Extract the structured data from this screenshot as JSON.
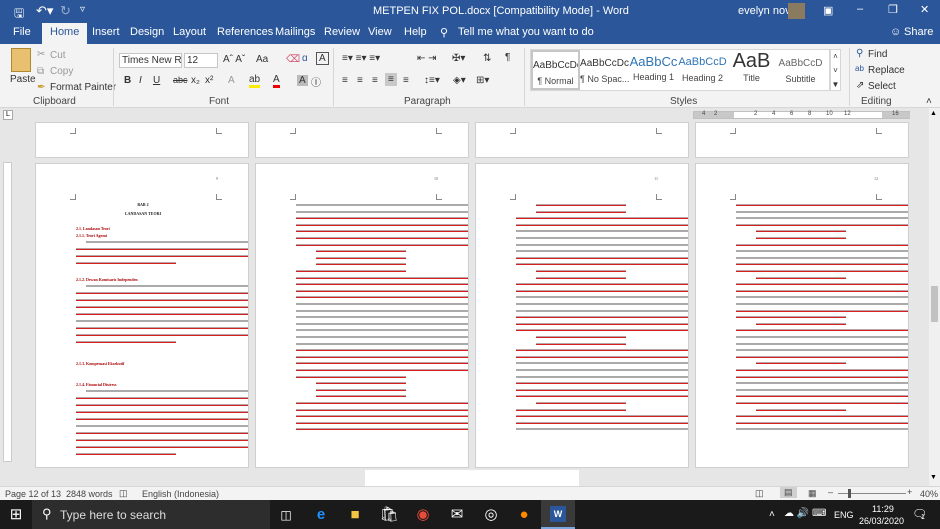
{
  "titlebar": {
    "title": "METPEN FIX POL.docx [Compatibility Mode]  -  Word",
    "user": "evelyn nova",
    "save_icon": "save-icon",
    "undo_icon": "undo-icon",
    "redo_icon": "redo-icon"
  },
  "tabs": [
    {
      "label": "File"
    },
    {
      "label": "Home",
      "active": true
    },
    {
      "label": "Insert"
    },
    {
      "label": "Design"
    },
    {
      "label": "Layout"
    },
    {
      "label": "References"
    },
    {
      "label": "Mailings"
    },
    {
      "label": "Review"
    },
    {
      "label": "View"
    },
    {
      "label": "Help"
    }
  ],
  "tell_me": "Tell me what you want to do",
  "share": "Share",
  "clipboard": {
    "paste": "Paste",
    "cut": "Cut",
    "copy": "Copy",
    "format_painter": "Format Painter",
    "group": "Clipboard"
  },
  "font": {
    "name": "Times New R",
    "size": "12",
    "group": "Font",
    "case": "Aa"
  },
  "paragraph": {
    "group": "Paragraph"
  },
  "styles": {
    "group": "Styles",
    "items": [
      {
        "preview": "AaBbCcDc",
        "name": "¶ Normal"
      },
      {
        "preview": "AaBbCcDc",
        "name": "¶ No Spac..."
      },
      {
        "preview": "AaBbCc",
        "name": "Heading 1"
      },
      {
        "preview": "AaBbCcD",
        "name": "Heading 2"
      },
      {
        "preview": "AaB",
        "name": "Title"
      },
      {
        "preview": "AaBbCcD",
        "name": "Subtitle"
      }
    ]
  },
  "editing": {
    "find": "Find",
    "replace": "Replace",
    "select": "Select",
    "group": "Editing"
  },
  "ruler": {
    "ticks": [
      "4",
      "2",
      "2",
      "4",
      "6",
      "8",
      "10",
      "12",
      "16"
    ]
  },
  "pages": [
    {
      "num": "9",
      "headings": [
        "BAB 2",
        "LANDASAN TEORI",
        "2.1. Landasan Teori",
        "2.1.1. Teori Agensi",
        "2.1.2. Dewan Komisaris Independen",
        "2.1.3. Kompensasi Eksekutif",
        "2.1.4. Financial Distress"
      ]
    },
    {
      "num": "10"
    },
    {
      "num": "11"
    },
    {
      "num": "12"
    }
  ],
  "status": {
    "page": "Page 12 of 13",
    "words": "2848 words",
    "language": "English (Indonesia)",
    "zoom": "40%"
  },
  "taskbar": {
    "search": "Type here to search",
    "time": "11:29",
    "date": "26/03/2020",
    "lang": "ENG",
    "notifications": "1"
  },
  "colors": {
    "accent": "#2b579a",
    "taskbar": "#1a1a1a",
    "spell_error": "#d42020"
  }
}
